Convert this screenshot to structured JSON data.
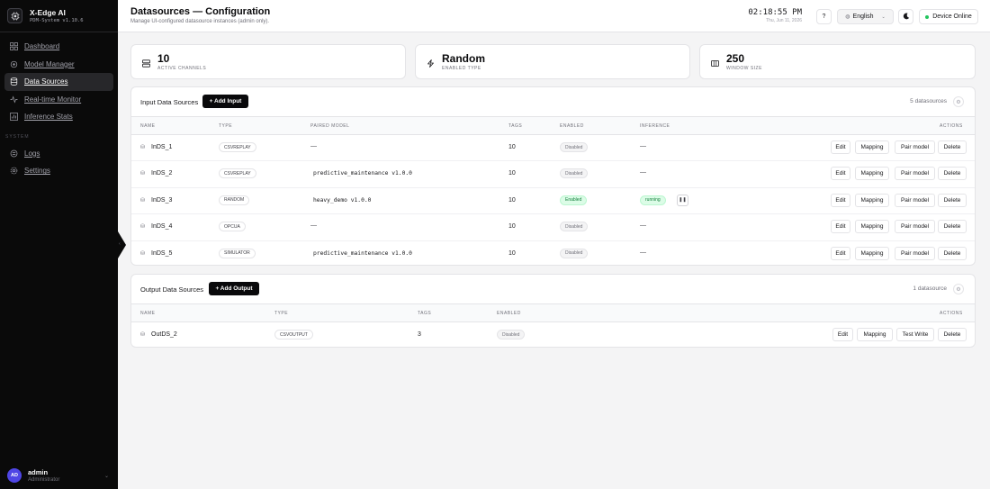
{
  "app": {
    "name": "X-Edge AI",
    "version": "PDM-System v1.10.6"
  },
  "sidebar": {
    "items": [
      {
        "label": "Dashboard",
        "icon": "dashboard-icon"
      },
      {
        "label": "Model Manager",
        "icon": "model-icon"
      },
      {
        "label": "Data Sources",
        "icon": "database-icon",
        "active": true
      },
      {
        "label": "Real-time Monitor",
        "icon": "activity-icon"
      },
      {
        "label": "Inference Stats",
        "icon": "chart-icon"
      }
    ],
    "system_label": "SYSTEM",
    "system_items": [
      {
        "label": "Logs",
        "icon": "logs-icon"
      },
      {
        "label": "Settings",
        "icon": "settings-icon"
      }
    ],
    "user": {
      "initials": "AD",
      "name": "admin",
      "role": "Administrator"
    }
  },
  "header": {
    "title": "Datasources — Configuration",
    "subtitle": "Manage UI-configured datasource instances (admin only).",
    "time": "02:18:55 PM",
    "date": "Thu, Jun 11, 2026",
    "help_label": "?",
    "language": "English",
    "status": "Device Online",
    "theme_icon": "moon-icon"
  },
  "stats": [
    {
      "value": "10",
      "label": "Active Channels",
      "icon": "server-icon"
    },
    {
      "value": "Random",
      "label": "Enabled Type",
      "icon": "bolt-icon"
    },
    {
      "value": "250",
      "label": "Window Size",
      "icon": "window-icon"
    }
  ],
  "inputs": {
    "title": "Input Data Sources",
    "add_label": "+ Add Input",
    "count": "5 datasources",
    "columns": {
      "name": "Name",
      "type": "Type",
      "model": "Paired Model",
      "tags": "Tags",
      "enabled": "Enabled",
      "inference": "Inference",
      "actions": "Actions"
    },
    "actions": [
      "Edit",
      "Mapping",
      "Pair model",
      "Delete"
    ],
    "rows": [
      {
        "name": "InDS_1",
        "type": "CSVREPLAY",
        "model": "—",
        "tags": "10",
        "enabled": "Disabled",
        "inference": "—"
      },
      {
        "name": "InDS_2",
        "type": "CSVREPLAY",
        "model": "predictive_maintenance v1.0.0",
        "tags": "10",
        "enabled": "Disabled",
        "inference": "—"
      },
      {
        "name": "InDS_3",
        "type": "RANDOM",
        "model": "heavy_demo v1.0.0",
        "tags": "10",
        "enabled": "Enabled",
        "inference": "running"
      },
      {
        "name": "InDS_4",
        "type": "OPCUA",
        "model": "—",
        "tags": "10",
        "enabled": "Disabled",
        "inference": "—"
      },
      {
        "name": "InDS_5",
        "type": "SIMULATOR",
        "model": "predictive_maintenance v1.0.0",
        "tags": "10",
        "enabled": "Disabled",
        "inference": "—"
      }
    ]
  },
  "outputs": {
    "title": "Output Data Sources",
    "add_label": "+ Add Output",
    "count": "1 datasource",
    "columns": {
      "name": "Name",
      "type": "Type",
      "tags": "Tags",
      "enabled": "Enabled",
      "actions": "Actions"
    },
    "actions": [
      "Edit",
      "Mapping",
      "Test Write",
      "Delete"
    ],
    "rows": [
      {
        "name": "OutDS_2",
        "type": "CSVOUTPUT",
        "tags": "3",
        "enabled": "Disabled"
      }
    ]
  },
  "colors": {
    "sidebar_bg": "#0a0a0a",
    "accent": "#09090b",
    "success": "#22c55e",
    "avatar": "#4f46e5"
  }
}
